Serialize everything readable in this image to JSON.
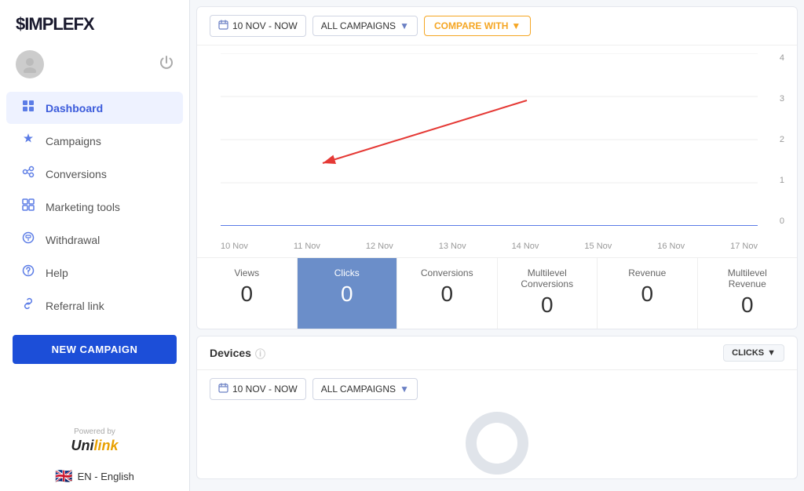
{
  "sidebar": {
    "logo": "$IMPLEFX",
    "logo_dollar": "$",
    "logo_rest": "IMPLEFX",
    "nav_items": [
      {
        "id": "dashboard",
        "label": "Dashboard",
        "icon": "⊙",
        "active": true
      },
      {
        "id": "campaigns",
        "label": "Campaigns",
        "icon": "🔔",
        "active": false
      },
      {
        "id": "conversions",
        "label": "Conversions",
        "icon": "⚙",
        "active": false
      },
      {
        "id": "marketing-tools",
        "label": "Marketing tools",
        "icon": "▦",
        "active": false
      },
      {
        "id": "withdrawal",
        "label": "Withdrawal",
        "icon": "◎",
        "active": false
      },
      {
        "id": "help",
        "label": "Help",
        "icon": "⊕",
        "active": false
      },
      {
        "id": "referral-link",
        "label": "Referral link",
        "icon": "⊛",
        "active": false
      }
    ],
    "new_campaign_label": "NEW CAMPAIGN",
    "powered_by": "Powered by",
    "unilink": "Unilink",
    "lang_label": "EN - English"
  },
  "toolbar": {
    "date_range": "10 NOV - NOW",
    "campaigns_label": "ALL CAMPAIGNS",
    "compare_label": "COMPARE WITH"
  },
  "chart": {
    "y_labels": [
      "4",
      "3",
      "2",
      "1",
      "0"
    ],
    "x_labels": [
      "10 Nov",
      "11 Nov",
      "12 Nov",
      "13 Nov",
      "14 Nov",
      "15 Nov",
      "16 Nov",
      "17 Nov"
    ]
  },
  "stats": [
    {
      "id": "views",
      "label": "Views",
      "value": "0",
      "active": false
    },
    {
      "id": "clicks",
      "label": "Clicks",
      "value": "0",
      "active": true
    },
    {
      "id": "conversions",
      "label": "Conversions",
      "value": "0",
      "active": false
    },
    {
      "id": "multilevel-conversions",
      "label": "Multilevel Conversions",
      "value": "0",
      "active": false
    },
    {
      "id": "revenue",
      "label": "Revenue",
      "value": "0",
      "active": false
    },
    {
      "id": "multilevel-revenue",
      "label": "Multilevel Revenue",
      "value": "0",
      "active": false
    }
  ],
  "devices": {
    "title": "Devices",
    "clicks_badge": "CLICKS",
    "date_range": "10 NOV - NOW",
    "campaigns_label": "ALL CAMPAIGNS"
  }
}
